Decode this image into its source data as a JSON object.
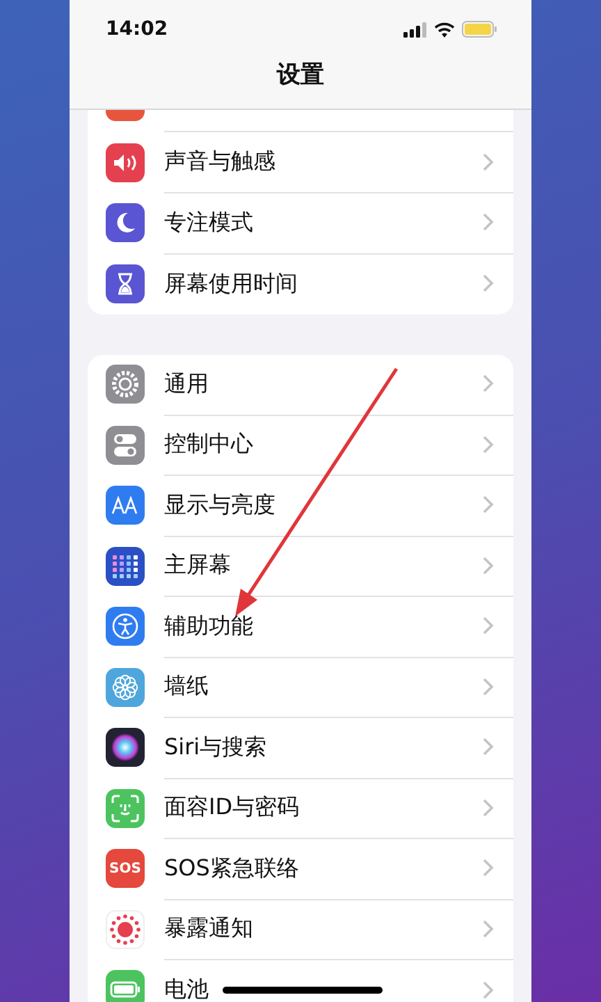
{
  "status_bar": {
    "time": "14:02",
    "low_power": true
  },
  "title": "设置",
  "groups": [
    {
      "items": [
        {
          "kind": "sound",
          "label": "声音与触感",
          "color": "#e5404f"
        },
        {
          "kind": "focus",
          "label": "专注模式",
          "color": "#5a55d2"
        },
        {
          "kind": "screen_time",
          "label": "屏幕使用时间",
          "color": "#5a55d2"
        }
      ]
    },
    {
      "items": [
        {
          "kind": "general",
          "label": "通用",
          "color": "#8e8e93"
        },
        {
          "kind": "control",
          "label": "控制中心",
          "color": "#8e8e93"
        },
        {
          "kind": "display",
          "label": "显示与亮度",
          "color": "#2f7cf0"
        },
        {
          "kind": "home",
          "label": "主屏幕",
          "color": "#2b4fc4"
        },
        {
          "kind": "accessibility",
          "label": "辅助功能",
          "color": "#2f7cf0"
        },
        {
          "kind": "wallpaper",
          "label": "墙纸",
          "color": "#4ea6dc"
        },
        {
          "kind": "siri",
          "label": "Siri与搜索",
          "color": "#222233"
        },
        {
          "kind": "face",
          "label": "面容ID与密码",
          "color": "#4cc35f"
        },
        {
          "kind": "sos",
          "label": "SOS紧急联络",
          "color": "#e5483c",
          "badge": "SOS"
        },
        {
          "kind": "exposure",
          "label": "暴露通知",
          "color": "#ffffff"
        },
        {
          "kind": "battery",
          "label": "电池",
          "color": "#4cc35f"
        }
      ]
    }
  ]
}
